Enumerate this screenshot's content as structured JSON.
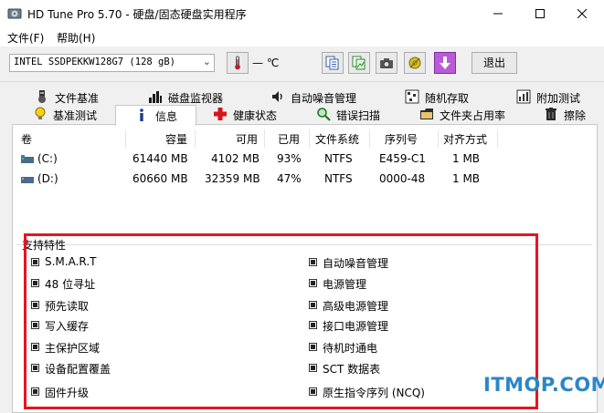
{
  "window": {
    "title": "HD Tune Pro 5.70 - 硬盘/固态硬盘实用程序"
  },
  "menu": [
    {
      "label": "文件(F)"
    },
    {
      "label": "帮助(H)"
    }
  ],
  "toolbar": {
    "drive": "INTEL SSDPEKKW128G7 (128 gB)",
    "temperature": "— ℃",
    "exit_label": "退出"
  },
  "tabs_top": [
    {
      "label": "文件基准"
    },
    {
      "label": "磁盘监视器"
    },
    {
      "label": "自动噪音管理"
    },
    {
      "label": "随机存取"
    },
    {
      "label": "附加测试"
    }
  ],
  "tabs_bottom": [
    {
      "label": "基准测试"
    },
    {
      "label": "信息"
    },
    {
      "label": "健康状态"
    },
    {
      "label": "错误扫描"
    },
    {
      "label": "文件夹占用率"
    },
    {
      "label": "擦除"
    }
  ],
  "volume_table": {
    "headers": [
      "卷",
      "容量",
      "可用",
      "已用",
      "文件系统",
      "序列号",
      "对齐方式"
    ],
    "rows": [
      [
        "(C:)",
        "61440 MB",
        "4102 MB",
        "93%",
        "NTFS",
        "E459-C1",
        "1 MB"
      ],
      [
        "(D:)",
        "60660 MB",
        "32359 MB",
        "47%",
        "NTFS",
        "0000-48",
        "1 MB"
      ]
    ]
  },
  "features": {
    "title": "支持特性",
    "left": [
      "S.M.A.R.T",
      "48 位寻址",
      "预先读取",
      "写入缓存",
      "主保护区域",
      "设备配置覆盖",
      "固件升级"
    ],
    "right": [
      "自动噪音管理",
      "电源管理",
      "高级电源管理",
      "接口电源管理",
      "待机时通电",
      "SCT 数据表",
      "原生指令序列 (NCQ)"
    ]
  },
  "watermark": "ITMOP.COM",
  "colors": {
    "highlight": "#e8141e",
    "watermark": "#2b86c9"
  }
}
